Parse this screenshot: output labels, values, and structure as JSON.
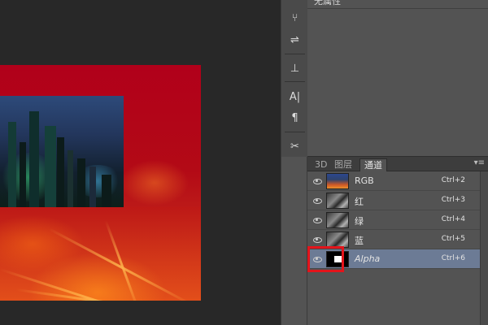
{
  "properties_panel": {
    "title": "无属性"
  },
  "tool_column": {
    "tools": [
      {
        "name": "brush-presets-icon",
        "glyph": "⑂"
      },
      {
        "name": "brush-settings-icon",
        "glyph": "⇌"
      },
      {
        "name": "clone-source-icon",
        "glyph": "⊥"
      },
      {
        "name": "character-icon",
        "glyph": "A|"
      },
      {
        "name": "paragraph-icon",
        "glyph": "¶"
      },
      {
        "name": "tool-presets-icon",
        "glyph": "✂"
      }
    ]
  },
  "tabs": [
    {
      "label": "3D",
      "active": false
    },
    {
      "label": "图层",
      "active": false
    },
    {
      "label": "通道",
      "active": true
    }
  ],
  "channels": [
    {
      "name": "RGB",
      "shortcut": "Ctrl+2",
      "selected": false,
      "visible": true
    },
    {
      "name": "红",
      "shortcut": "Ctrl+3",
      "selected": false,
      "visible": true
    },
    {
      "name": "绿",
      "shortcut": "Ctrl+4",
      "selected": false,
      "visible": true
    },
    {
      "name": "蓝",
      "shortcut": "Ctrl+5",
      "selected": false,
      "visible": true
    },
    {
      "name": "Alpha",
      "shortcut": "Ctrl+6",
      "selected": true,
      "visible": true
    }
  ],
  "colors": {
    "highlight": "#e4141b",
    "selected_row": "#6c7b95"
  }
}
